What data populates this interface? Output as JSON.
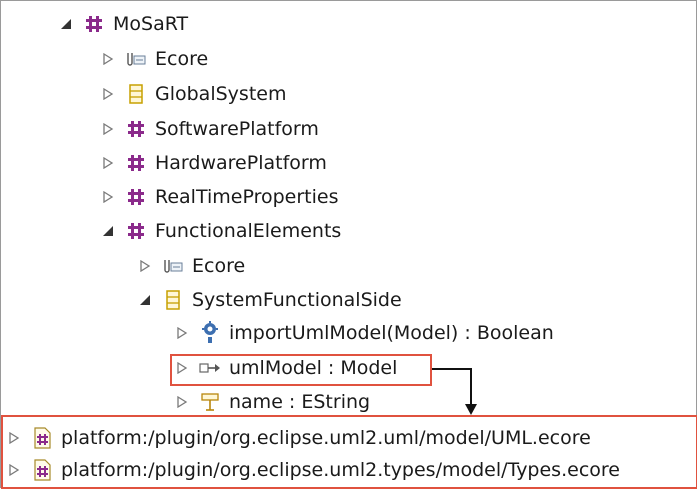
{
  "tree": {
    "root": "MoSaRT",
    "root_children": [
      "Ecore",
      "GlobalSystem",
      "SoftwarePlatform",
      "HardwarePlatform",
      "RealTimeProperties",
      "FunctionalElements"
    ],
    "functional_children": [
      "Ecore",
      "SystemFunctionalSide"
    ],
    "side_children": [
      "importUmlModel(Model) : Boolean",
      "umlModel : Model",
      "name : EString"
    ]
  },
  "resources": [
    "platform:/plugin/org.eclipse.uml2.uml/model/UML.ecore",
    "platform:/plugin/org.eclipse.uml2.types/model/Types.ecore"
  ],
  "colors": {
    "highlight": "#e0523f",
    "package": "#8b2a8b",
    "class": "#c7a000",
    "twisty": "#7a7a7a"
  }
}
